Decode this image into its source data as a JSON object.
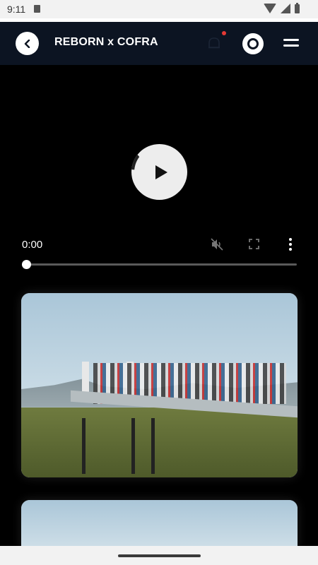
{
  "status_bar": {
    "time": "9:11",
    "icons": [
      "sd-card-icon",
      "wifi-icon",
      "signal-icon",
      "battery-icon"
    ]
  },
  "header": {
    "title": "REBORN x COFRA",
    "back_icon": "chevron-left-icon",
    "notification_icon": "bell-icon",
    "has_notification": true,
    "logo_icon": "ring-logo",
    "menu_icon": "hamburger-icon",
    "accent_color": "#e53935",
    "background_color": "#0c1422"
  },
  "video_player": {
    "current_time": "0:00",
    "progress": 0,
    "icons": [
      "play-icon",
      "mute-icon",
      "fullscreen-icon",
      "more-vert-icon"
    ]
  },
  "gallery": {
    "photos": [
      {
        "name": "outdoor-cycling-class-photo"
      },
      {
        "name": "outdoor-cycling-class-photo-2"
      }
    ]
  }
}
